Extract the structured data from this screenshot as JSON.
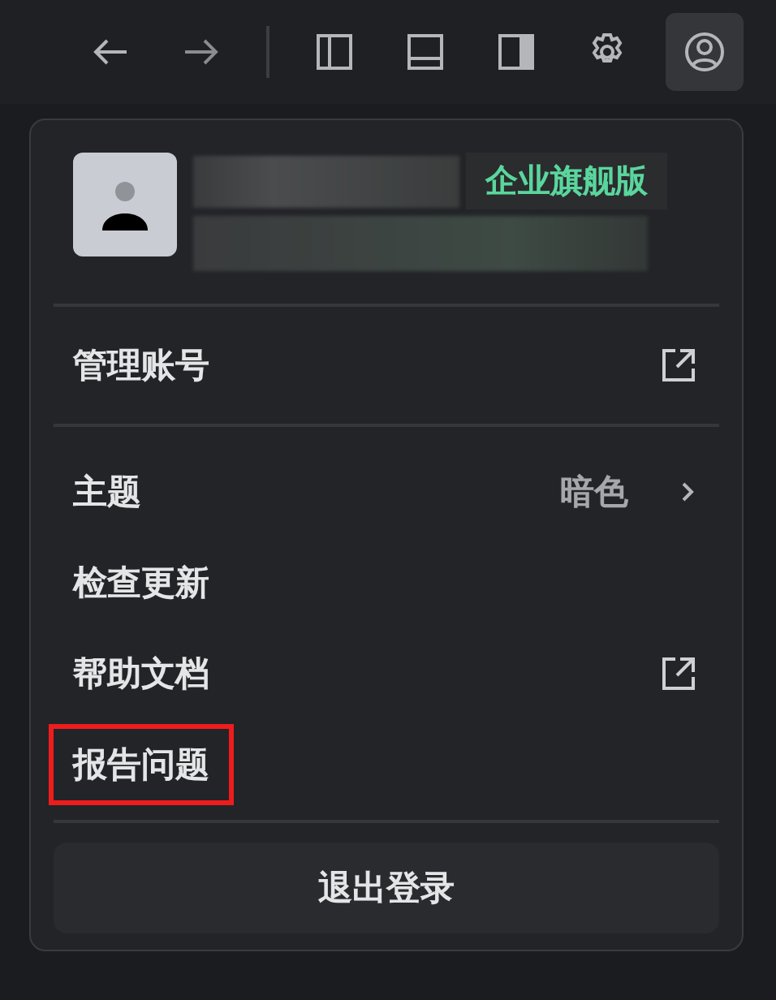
{
  "toolbar": [
    {
      "kind": "back",
      "selected": false
    },
    {
      "kind": "forward",
      "selected": false
    },
    {
      "kind": "separator"
    },
    {
      "kind": "left-panel",
      "selected": false
    },
    {
      "kind": "bottom-panel",
      "selected": false
    },
    {
      "kind": "right-panel",
      "selected": false
    },
    {
      "kind": "settings",
      "selected": false
    },
    {
      "kind": "account",
      "selected": true
    }
  ],
  "account_menu": {
    "profile": {
      "badge": "企业旗舰版"
    },
    "account_item": {
      "label": "管理账号",
      "kind": "external"
    },
    "items": [
      {
        "label": "主题",
        "kind": "submenu",
        "value": "暗色",
        "highlighted": false
      },
      {
        "label": "检查更新",
        "kind": "plain",
        "highlighted": false
      },
      {
        "label": "帮助文档",
        "kind": "external",
        "highlighted": false
      },
      {
        "label": "报告问题",
        "kind": "plain",
        "highlighted": true
      }
    ],
    "logout": "退出登录"
  }
}
